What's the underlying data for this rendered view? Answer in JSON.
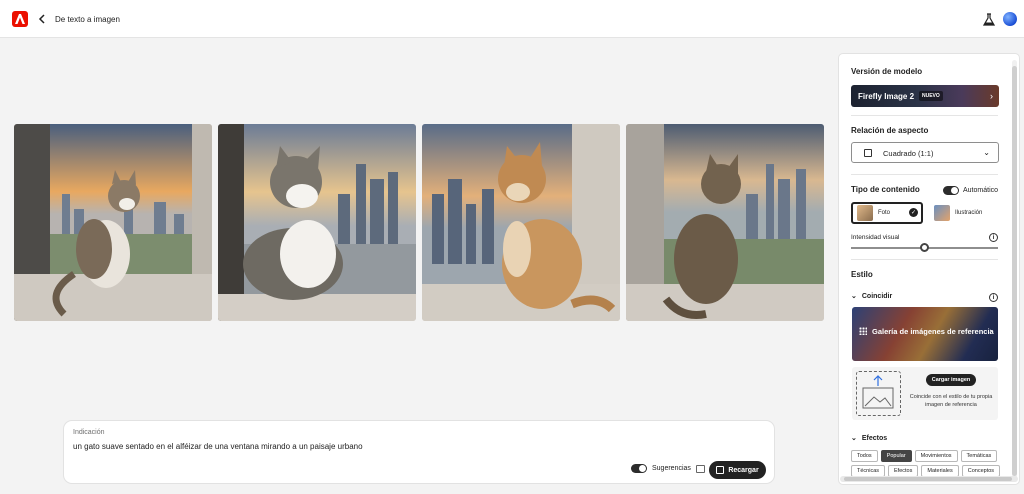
{
  "topbar": {
    "breadcrumb": "De texto a imagen",
    "icons": [
      "adobe-logo-icon",
      "chevron-left-icon",
      "flask-icon",
      "avatar-globe-icon"
    ]
  },
  "gallery": {
    "images": [
      {
        "name": "generated-image-1",
        "description_icon": "cat-photo"
      },
      {
        "name": "generated-image-2",
        "description_icon": "cat-photo"
      },
      {
        "name": "generated-image-3",
        "description_icon": "cat-photo"
      },
      {
        "name": "generated-image-4",
        "description_icon": "cat-photo"
      }
    ]
  },
  "prompt": {
    "label": "Indicación",
    "value": "un gato suave sentado en el alféizar de una ventana mirando a un paisaje urbano",
    "suggestions_label": "Sugerencias",
    "suggestions_on": true,
    "reload_label": "Recargar"
  },
  "panel": {
    "model_version_title": "Versión de modelo",
    "model_name": "Firefly Image 2",
    "model_badge": "NUEVO",
    "aspect_title": "Relación de aspecto",
    "aspect_value": "Cuadrado (1:1)",
    "content_type_title": "Tipo de contenido",
    "auto_label": "Automático",
    "auto_on": true,
    "content_types": [
      {
        "label": "Foto",
        "selected": true
      },
      {
        "label": "Ilustración",
        "selected": false
      }
    ],
    "intensity_label": "Intensidad visual",
    "intensity_fraction": 0.5,
    "style_title": "Estilo",
    "match_label": "Coincidir",
    "gallery_label": "Galería de imágenes de referencia",
    "upload_button": "Cargar imagen",
    "upload_desc": "Coincide con el estilo de tu propia imagen de referencia",
    "effects_label": "Efectos",
    "effect_chips": [
      {
        "label": "Todos",
        "active": false
      },
      {
        "label": "Popular",
        "active": true
      },
      {
        "label": "Movimientos",
        "active": false
      },
      {
        "label": "Temáticas",
        "active": false
      },
      {
        "label": "Técnicas",
        "active": false
      },
      {
        "label": "Efectos",
        "active": false
      },
      {
        "label": "Materiales",
        "active": false
      },
      {
        "label": "Conceptos",
        "active": false
      }
    ]
  },
  "colors": {
    "accent": "#eb1000",
    "dark": "#222222",
    "background": "#f3f3f3"
  }
}
